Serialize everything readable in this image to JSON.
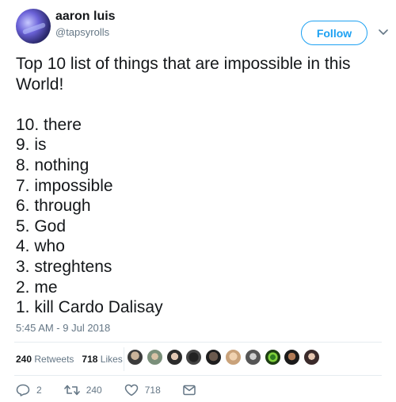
{
  "user": {
    "name": "aaron luis",
    "handle": "@tapsyrolls"
  },
  "follow_label": "Follow",
  "tweet": {
    "intro_line1": "Top 10 list of things that are impossible in this",
    "intro_line2": "World!",
    "items": [
      "10. there",
      "9. is",
      "8. nothing",
      "7. impossible",
      "6. through",
      "5. God",
      "4. who",
      "3. streghtens",
      "2. me",
      "1. kill Cardo Dalisay"
    ]
  },
  "timestamp": "5:45 AM - 9 Jul 2018",
  "stats": {
    "retweets_count": "240",
    "retweets_label": "Retweets",
    "likes_count": "718",
    "likes_label": "Likes"
  },
  "actions": {
    "reply_count": "2",
    "retweet_count": "240",
    "like_count": "718"
  },
  "colors": {
    "accent": "#1da1f2",
    "text": "#14171a",
    "secondary": "#657786"
  },
  "icons": [
    "chevron-down-icon",
    "reply-icon",
    "retweet-icon",
    "like-icon",
    "message-icon"
  ]
}
